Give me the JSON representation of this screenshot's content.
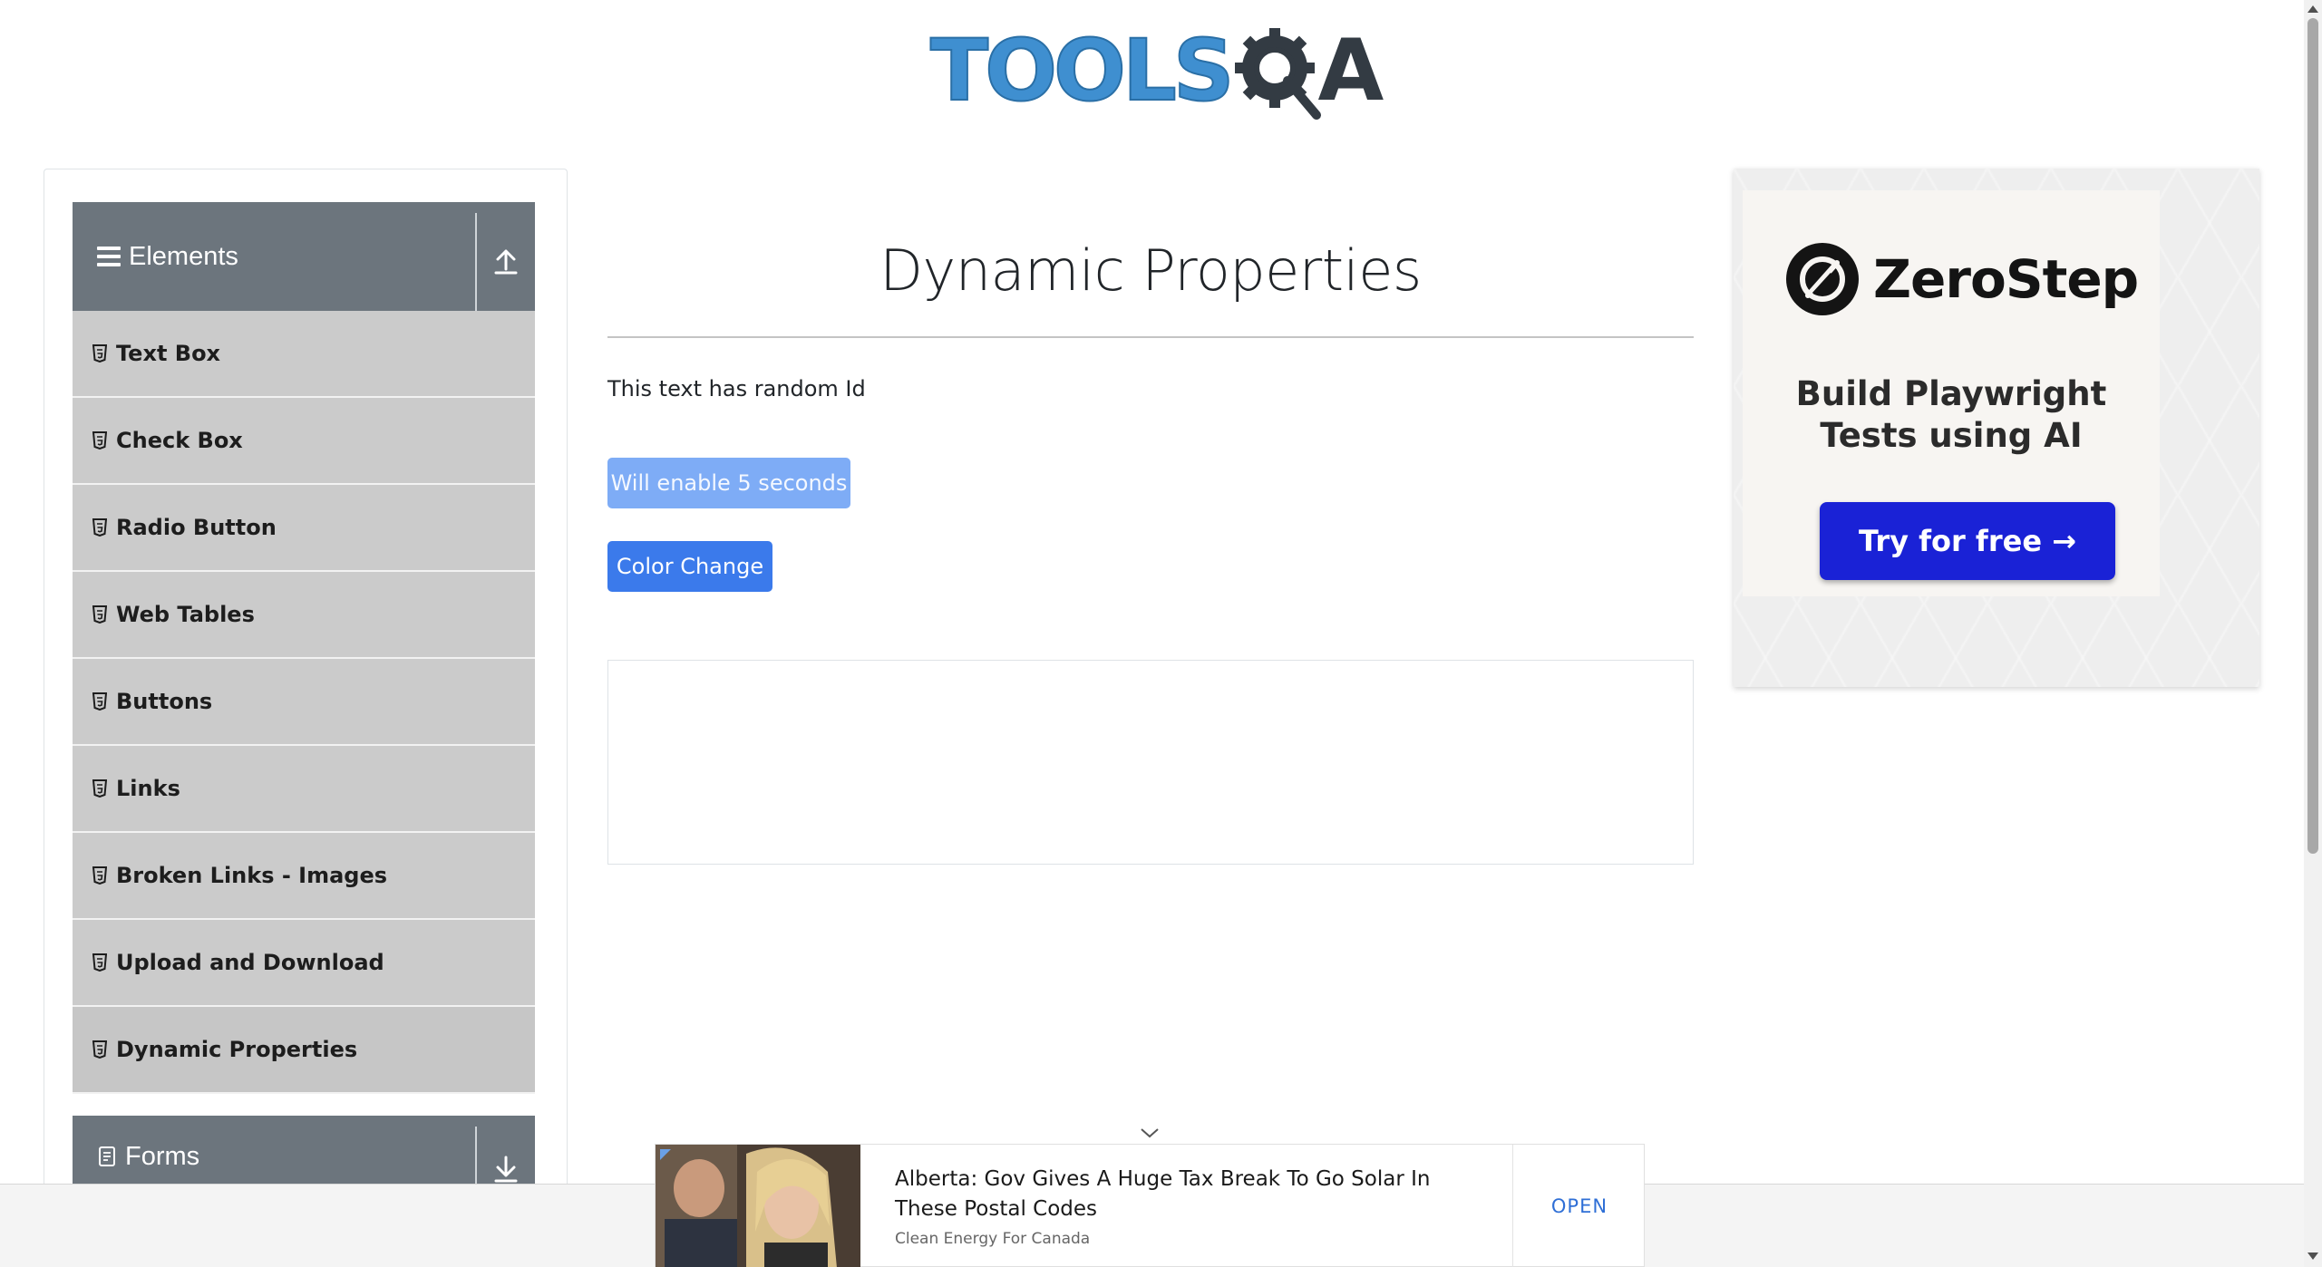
{
  "header": {
    "logo_text_left": "TOOLS",
    "logo_text_right": "A"
  },
  "sidebar": {
    "elements_group": {
      "title": "Elements",
      "items": [
        {
          "label": "Text Box"
        },
        {
          "label": "Check Box"
        },
        {
          "label": "Radio Button"
        },
        {
          "label": "Web Tables"
        },
        {
          "label": "Buttons"
        },
        {
          "label": "Links"
        },
        {
          "label": "Broken Links - Images"
        },
        {
          "label": "Upload and Download"
        },
        {
          "label": "Dynamic Properties"
        }
      ],
      "active_item": "Dynamic Properties"
    },
    "forms_group": {
      "title": "Forms"
    }
  },
  "main": {
    "title": "Dynamic Properties",
    "random_id_text": "This text has random Id",
    "enable_button_label": "Will enable 5 seconds",
    "color_change_button_label": "Color Change"
  },
  "right_ad": {
    "brand": "ZeroStep",
    "tagline_line1": "Build Playwright",
    "tagline_line2": "Tests using AI",
    "cta_label": "Try for free →"
  },
  "bottom_ad": {
    "headline": "Alberta: Gov Gives A Huge Tax Break To Go Solar In These Postal Codes",
    "source": "Clean Energy For Canada",
    "open_label": "OPEN"
  },
  "colors": {
    "group_header_bg": "#6c757d",
    "menu_item_bg": "#cbcbcb",
    "primary_button": "#3b7aeb",
    "disabled_button": "#7eacf6",
    "logo_blue": "#3f8fd0",
    "logo_dark": "#333b43",
    "ad_cta_blue": "#1a22d6",
    "open_link": "#2f6fd6"
  }
}
